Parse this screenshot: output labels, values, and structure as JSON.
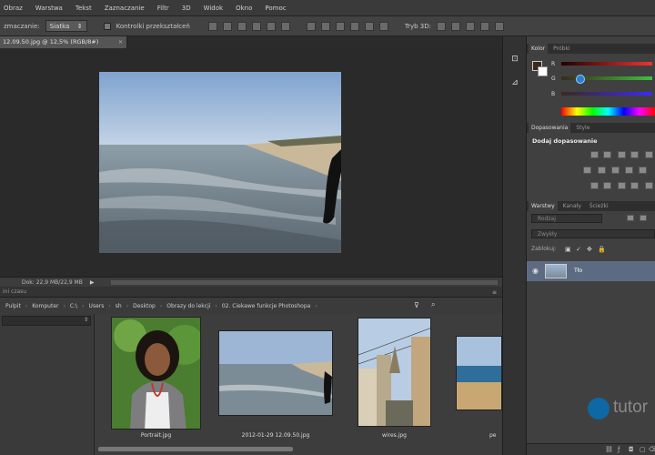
{
  "menu": [
    "Obraz",
    "Warstwa",
    "Tekst",
    "Zaznaczanie",
    "Filtr",
    "3D",
    "Widok",
    "Okno",
    "Pomoc"
  ],
  "options": {
    "mode_label": "zmaczanie:",
    "mode_value": "Siatka",
    "checkbox_label": "Kontrolki przekształceń",
    "mode_3d_label": "Tryb 3D:"
  },
  "document": {
    "tab_title": "12.09.50.jpg @ 12,5% (RGB/8#)",
    "status": "Dok: 22,9 MB/22,9 MB"
  },
  "bridge": {
    "header": "ini czasu",
    "path": [
      "Pulpit",
      "Komputer",
      "C:\\",
      "Users",
      "sh",
      "Desktop",
      "Obrazy do lekcji",
      "02. Ciekawe funkcje Photoshopa"
    ],
    "thumbnails": [
      {
        "caption": "Portrait.jpg"
      },
      {
        "caption": "2012-01-29 12.09.50.jpg"
      },
      {
        "caption": "wires.jpg"
      },
      {
        "caption": "pe"
      }
    ]
  },
  "panels": {
    "color_tabs": [
      "Kolor",
      "Próbki"
    ],
    "channels": [
      "R",
      "G",
      "B"
    ],
    "adjust_tabs": [
      "Dopasowania",
      "Style"
    ],
    "adjust_title": "Dodaj dopasowanie",
    "layer_tabs": [
      "Warstwy",
      "Kanały",
      "Ścieżki"
    ],
    "layer_kind": "Rodzaj",
    "blend_mode": "Zwykły",
    "lock_label": "Zablokuj:",
    "layer_name": "Tło"
  },
  "watermark": "tutor",
  "colors": {
    "accent": "#0072bc",
    "panel_bg": "#404040",
    "canvas_bg": "#2a2a2a"
  }
}
